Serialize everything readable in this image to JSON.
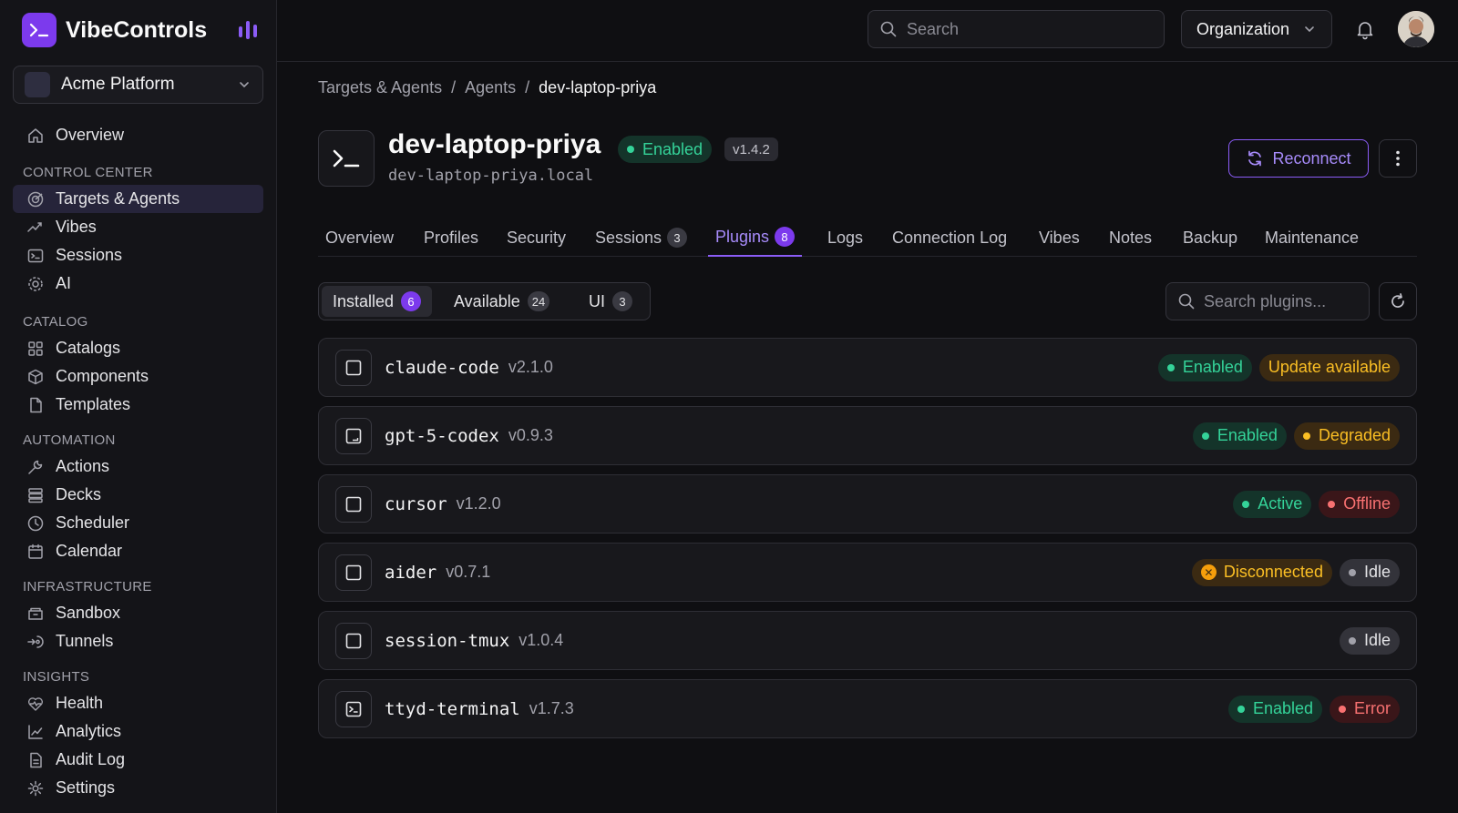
{
  "brand": {
    "name": "VibeControls"
  },
  "workspace": {
    "name": "Acme Platform"
  },
  "nav": {
    "overview": "Overview",
    "sections": {
      "control_center": "CONTROL CENTER",
      "catalog": "CATALOG",
      "automation": "AUTOMATION",
      "infrastructure": "INFRASTRUCTURE",
      "insights": "INSIGHTS"
    },
    "items": {
      "targets": "Targets & Agents",
      "vibes": "Vibes",
      "sessions": "Sessions",
      "ai": "AI",
      "catalogs": "Catalogs",
      "components": "Components",
      "templates": "Templates",
      "actions": "Actions",
      "decks": "Decks",
      "scheduler": "Scheduler",
      "calendar": "Calendar",
      "sandbox": "Sandbox",
      "tunnels": "Tunnels",
      "health": "Health",
      "analytics": "Analytics",
      "audit_log": "Audit Log",
      "settings": "Settings"
    }
  },
  "topbar": {
    "search_placeholder": "Search",
    "org_label": "Organization"
  },
  "breadcrumb": {
    "items": [
      "Targets & Agents",
      "Agents"
    ],
    "current": "dev-laptop-priya"
  },
  "agent": {
    "name": "dev-laptop-priya",
    "host": "dev-laptop-priya.local",
    "status": "Enabled",
    "version": "v1.4.2",
    "reconnect_label": "Reconnect"
  },
  "tabs": [
    {
      "label": "Overview"
    },
    {
      "label": "Profiles"
    },
    {
      "label": "Security"
    },
    {
      "label": "Sessions",
      "count": "3"
    },
    {
      "label": "Plugins",
      "count": "8",
      "active": true
    },
    {
      "label": "Logs"
    },
    {
      "label": "Connection Log"
    },
    {
      "label": "Vibes"
    },
    {
      "label": "Notes"
    },
    {
      "label": "Backup"
    },
    {
      "label": "Maintenance"
    }
  ],
  "plugin_filter": {
    "installed": {
      "label": "Installed",
      "count": "6"
    },
    "available": {
      "label": "Available",
      "count": "24"
    },
    "ui": {
      "label": "UI",
      "count": "3"
    },
    "search_placeholder": "Search plugins..."
  },
  "plugins": [
    {
      "name": "claude-code",
      "version": "v2.1.0",
      "badges": [
        {
          "label": "Enabled",
          "kind": "green"
        },
        {
          "label": "Update available",
          "kind": "amber"
        }
      ]
    },
    {
      "name": "gpt-5-codex",
      "version": "v0.9.3",
      "badges": [
        {
          "label": "Enabled",
          "kind": "green"
        },
        {
          "label": "Degraded",
          "kind": "amber"
        }
      ]
    },
    {
      "name": "cursor",
      "version": "v1.2.0",
      "badges": [
        {
          "label": "Active",
          "kind": "green"
        },
        {
          "label": "Offline",
          "kind": "red"
        }
      ]
    },
    {
      "name": "aider",
      "version": "v0.7.1",
      "badges": [
        {
          "label": "Disconnected",
          "kind": "amber-x"
        },
        {
          "label": "Idle",
          "kind": "gray"
        }
      ]
    },
    {
      "name": "session-tmux",
      "version": "v1.0.4",
      "badges": [
        {
          "label": "Idle",
          "kind": "gray"
        }
      ]
    },
    {
      "name": "ttyd-terminal",
      "version": "v1.7.3",
      "badges": [
        {
          "label": "Enabled",
          "kind": "green"
        },
        {
          "label": "Error",
          "kind": "red"
        }
      ]
    }
  ],
  "colors": {
    "accent": "#7c3aed",
    "success": "#34d399",
    "warning": "#fbbf24",
    "danger": "#f87171"
  }
}
